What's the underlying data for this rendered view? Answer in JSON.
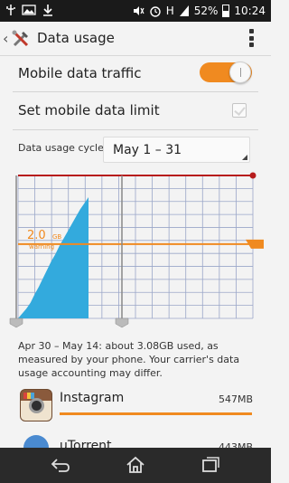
{
  "status_bar": {
    "battery": "52%",
    "time": "10:24",
    "signal": "H"
  },
  "action_bar": {
    "title": "Data usage"
  },
  "settings": {
    "mobile_data_traffic": {
      "label": "Mobile data traffic",
      "enabled": true
    },
    "set_mobile_data_limit": {
      "label": "Set mobile data limit",
      "checked": true
    },
    "data_usage_cycle": {
      "label": "Data usage cycle",
      "value": "May 1 – 31"
    }
  },
  "chart_data": {
    "type": "area",
    "warning_value": "2.0",
    "warning_unit": "GB",
    "warning_label": "warning",
    "usage_fraction_points": [
      0.0,
      0.04,
      0.08,
      0.13,
      0.2,
      0.26,
      0.33,
      0.4,
      0.47,
      0.53,
      0.6,
      0.66,
      0.72,
      0.78,
      0.84,
      0.9,
      0.95,
      1.0
    ],
    "range_fraction": 0.25,
    "warning_fraction": 0.52
  },
  "summary": "Apr 30 – May 14: about 3.08GB used, as measured by your phone. Your carrier's data usage accounting may differ.",
  "apps": [
    {
      "name": "Instagram",
      "size": "547MB"
    },
    {
      "name": "uTorrent",
      "size": "443MB"
    }
  ],
  "colors": {
    "accent": "#f08a20",
    "usage_fill": "#33aadd",
    "limit_line": "#b71c1c"
  }
}
